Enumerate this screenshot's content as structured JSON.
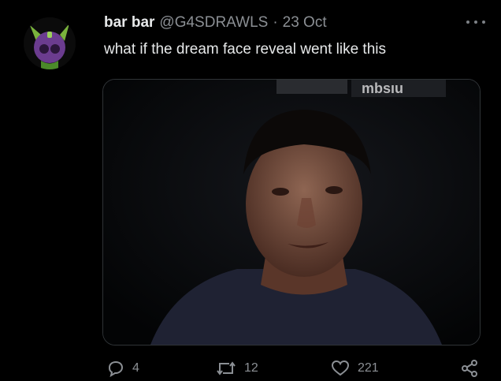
{
  "tweet": {
    "display_name": "bar bar",
    "handle": "@G4SDRAWLS",
    "separator": "·",
    "date": "23 Oct",
    "text": "what if the dream face reveal went like this",
    "media_overlay_text": "mbsıu"
  },
  "actions": {
    "reply_count": "4",
    "retweet_count": "12",
    "like_count": "221"
  },
  "colors": {
    "background": "#000000",
    "text_primary": "#e7e9ea",
    "text_secondary": "#8b8f94",
    "avatar_accent": "#7bbf3a"
  },
  "icons": [
    "more-icon",
    "reply-icon",
    "retweet-icon",
    "like-icon",
    "share-icon"
  ]
}
